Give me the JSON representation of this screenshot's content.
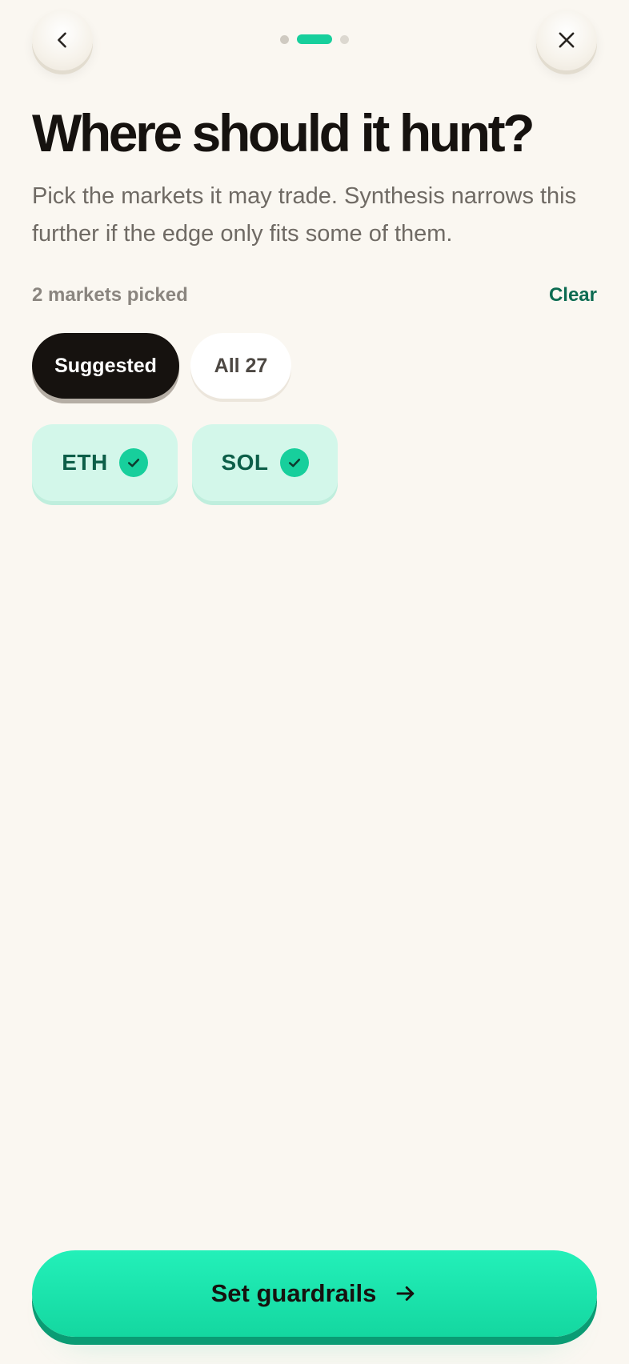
{
  "header": {
    "back_icon": "chevron-left-icon",
    "close_icon": "close-icon",
    "steps_total": 3,
    "steps_current": 2
  },
  "page": {
    "title": "Where should it hunt?",
    "subtitle": "Pick the markets it may trade. Synthesis narrows this further if the edge only fits some of them."
  },
  "selection": {
    "count_label": "2 markets picked",
    "clear_label": "Clear"
  },
  "filters": [
    {
      "label": "Suggested",
      "selected": true
    },
    {
      "label": "All 27",
      "selected": false
    }
  ],
  "markets": [
    {
      "label": "ETH",
      "checked": true
    },
    {
      "label": "SOL",
      "checked": true
    }
  ],
  "cta": {
    "label": "Set guardrails",
    "icon": "arrow-right-icon"
  },
  "colors": {
    "background": "#faf7f1",
    "accent": "#17cf9c",
    "accent_dark": "#0c6b51",
    "ink": "#16120f",
    "chip_bg": "#d3f7ea"
  }
}
